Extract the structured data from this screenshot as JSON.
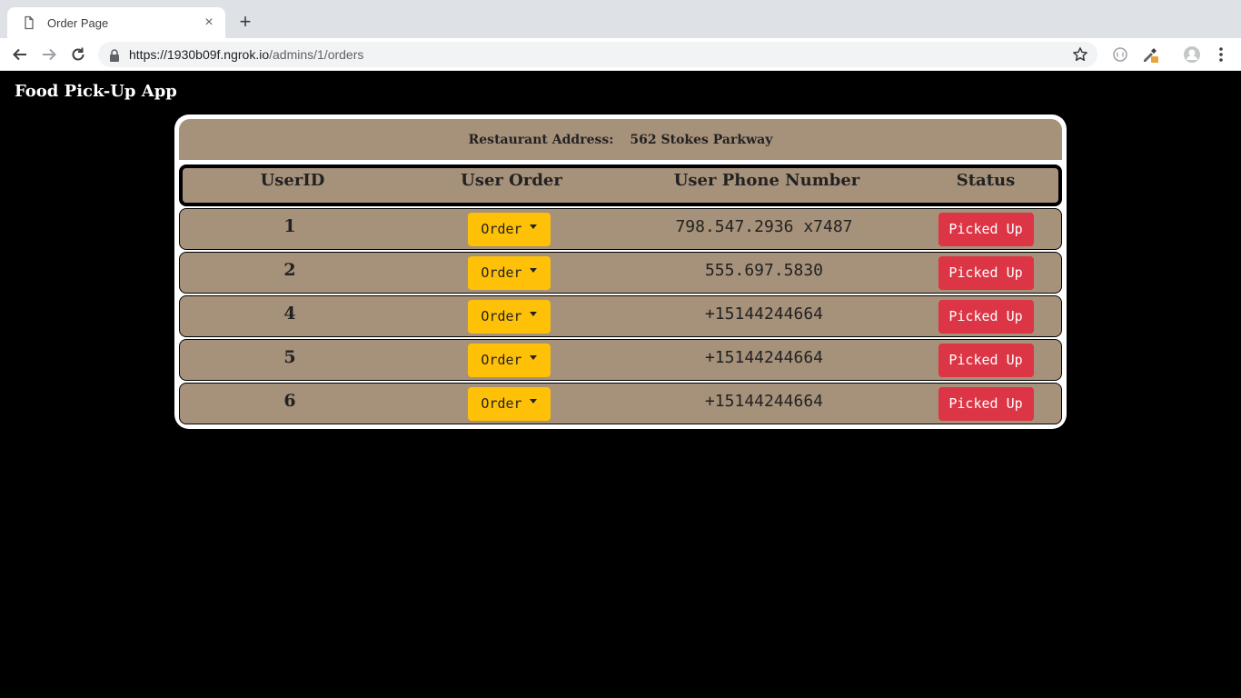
{
  "browser": {
    "tab_title": "Order Page",
    "tab_close": "×",
    "new_tab": "+",
    "url_host": "https://1930b09f.ngrok.io",
    "url_path": "/admins/1/orders"
  },
  "app": {
    "title": "Food Pick-Up App"
  },
  "restaurant": {
    "address_label": "Restaurant Address:",
    "address_value": "562 Stokes Parkway"
  },
  "table": {
    "headers": [
      "UserID",
      "User Order",
      "User Phone Number",
      "Status"
    ],
    "rows": [
      {
        "user_id": "1",
        "order_label": "Order",
        "phone": "798.547.2936 x7487",
        "status": "Picked Up"
      },
      {
        "user_id": "2",
        "order_label": "Order",
        "phone": "555.697.5830",
        "status": "Picked Up"
      },
      {
        "user_id": "4",
        "order_label": "Order",
        "phone": "+15144244664",
        "status": "Picked Up"
      },
      {
        "user_id": "5",
        "order_label": "Order",
        "phone": "+15144244664",
        "status": "Picked Up"
      },
      {
        "user_id": "6",
        "order_label": "Order",
        "phone": "+15144244664",
        "status": "Picked Up"
      }
    ]
  },
  "colors": {
    "row_bg": "#a6917a",
    "order_button": "#ffc107",
    "status_button": "#dc3545",
    "page_bg": "#000000"
  }
}
